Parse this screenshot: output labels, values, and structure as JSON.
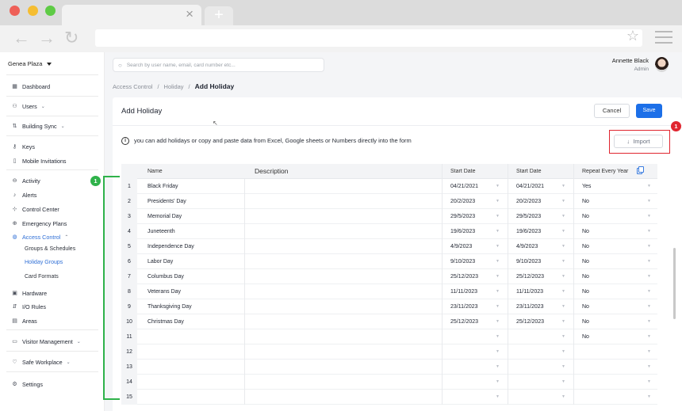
{
  "browser": {
    "tab_close": "×",
    "new_tab": "+",
    "back": "←",
    "forward": "→",
    "reload": "↻",
    "bookmark": "☆"
  },
  "sidebar": {
    "site": "Genea Plaza",
    "items": {
      "dashboard": "Dashboard",
      "users": "Users",
      "building_sync": "Building Sync",
      "keys": "Keys",
      "mobile_invitations": "Mobile Invitations",
      "activity": "Activity",
      "alerts": "Alerts",
      "control_center": "Control Center",
      "emergency_plans": "Emergency Plans",
      "access_control": "Access Control",
      "groups_schedules": "Groups & Schedules",
      "holiday_groups": "Holiday Groups",
      "card_formats": "Card Formats",
      "hardware": "Hardware",
      "io_rules": "I/O Rules",
      "areas": "Areas",
      "visitor_management": "Visitor Management",
      "safe_workplace": "Safe Workplace",
      "settings": "Settings"
    },
    "accent": "#2f6fd6"
  },
  "header": {
    "search_placeholder": "Search by user name, email, card number etc...",
    "user_name": "Annette Black",
    "user_role": "Admin"
  },
  "breadcrumb": [
    "Access Control",
    "Holiday",
    "Add Holiday"
  ],
  "breadcrumb_sep": "/",
  "card": {
    "title": "Add Holiday",
    "cancel": "Cancel",
    "save": "Save",
    "info": "you can add holidays or copy and paste data from Excel, Google sheets or Numbers directly into the form",
    "import": "Import",
    "import_icon": "↓"
  },
  "annotations": {
    "green": "1",
    "red": "1"
  },
  "table": {
    "columns": {
      "name": "Name",
      "description": "Description",
      "start1": "Start Date",
      "start2": "Start Date",
      "repeat": "Repeat Every Year"
    },
    "rows": [
      {
        "n": "1",
        "name": "Black Friday",
        "s1": "04/21/2021",
        "s2": "04/21/2021",
        "rep": "Yes"
      },
      {
        "n": "2",
        "name": "Presidents' Day",
        "s1": "20/2/2023",
        "s2": "20/2/2023",
        "rep": "No"
      },
      {
        "n": "3",
        "name": "Memorial Day",
        "s1": "29/5/2023",
        "s2": "29/5/2023",
        "rep": "No"
      },
      {
        "n": "4",
        "name": "Juneteenth",
        "s1": "19/6/2023",
        "s2": "19/6/2023",
        "rep": "No"
      },
      {
        "n": "5",
        "name": "Independence Day",
        "s1": "4/9/2023",
        "s2": "4/9/2023",
        "rep": "No"
      },
      {
        "n": "6",
        "name": "Labor Day",
        "s1": "9/10/2023",
        "s2": "9/10/2023",
        "rep": "No"
      },
      {
        "n": "7",
        "name": "Columbus Day",
        "s1": "25/12/2023",
        "s2": "25/12/2023",
        "rep": "No"
      },
      {
        "n": "8",
        "name": "Veterans Day",
        "s1": "11/11/2023",
        "s2": "11/11/2023",
        "rep": "No"
      },
      {
        "n": "9",
        "name": "Thanksgiving Day",
        "s1": "23/11/2023",
        "s2": "23/11/2023",
        "rep": "No"
      },
      {
        "n": "10",
        "name": "Christmas Day",
        "s1": "25/12/2023",
        "s2": "25/12/2023",
        "rep": "No"
      },
      {
        "n": "11",
        "name": "",
        "s1": "",
        "s2": "",
        "rep": "No"
      },
      {
        "n": "12",
        "name": "",
        "s1": "",
        "s2": "",
        "rep": ""
      },
      {
        "n": "13",
        "name": "",
        "s1": "",
        "s2": "",
        "rep": ""
      },
      {
        "n": "14",
        "name": "",
        "s1": "",
        "s2": "",
        "rep": ""
      },
      {
        "n": "15",
        "name": "",
        "s1": "",
        "s2": "",
        "rep": ""
      }
    ]
  }
}
